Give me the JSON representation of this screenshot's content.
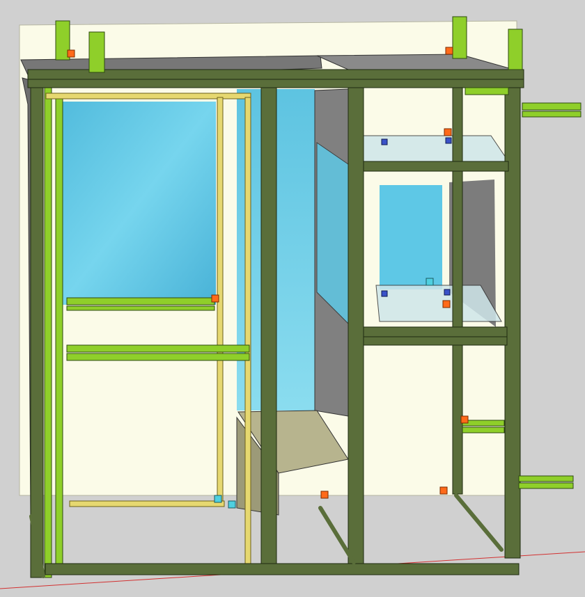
{
  "scene": {
    "title": "",
    "description_visible_text": "",
    "colors": {
      "background": "#d0d0d0",
      "back_wall": "#fbfbe8",
      "extrusion_dark": "#5a6e3a",
      "extrusion_light": "#8fcf2a",
      "extrusion_yellow": "#e6d870",
      "glass_blue": "#5ec8e6",
      "connector_orange": "#ff6a1a",
      "connector_blue": "#3a52c8",
      "shelf_tan": "#b7b48e",
      "panel_gray": "#7a7a7a",
      "axis_red": "#d23030"
    }
  }
}
